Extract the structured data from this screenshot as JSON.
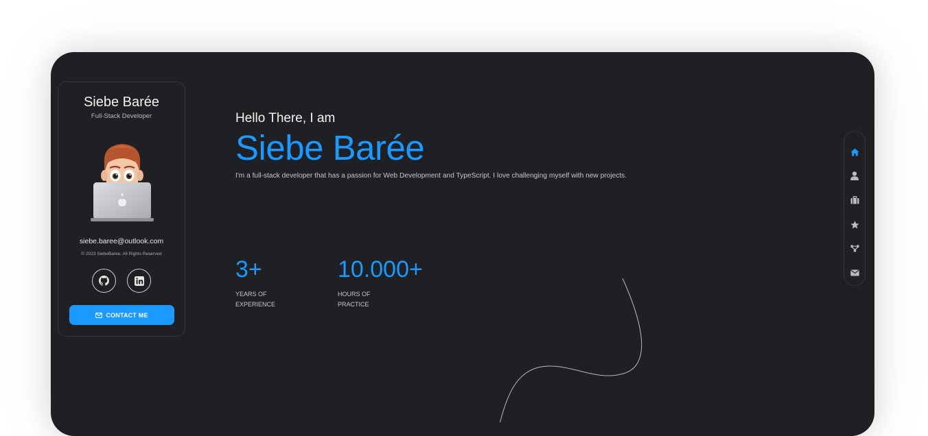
{
  "profile": {
    "name": "Siebe Barée",
    "role": "Full-Stack Developer",
    "email": "siebe.baree@outlook.com",
    "copyright": "© 2023 SiebeBaree. All Rights Reserved",
    "socials": [
      {
        "icon": "github-icon"
      },
      {
        "icon": "linkedin-icon"
      }
    ],
    "contact_label": "CONTACT ME"
  },
  "hero": {
    "greeting": "Hello There, I am",
    "name": "Siebe Barée",
    "bio": "I'm a full-stack developer that has a passion for Web Development and TypeScript. I love challenging myself with new projects."
  },
  "stats": [
    {
      "value": "3+",
      "label": "YEARS OF EXPERIENCE"
    },
    {
      "value": "10.000+",
      "label": "HOURS OF PRACTICE"
    }
  ],
  "nav": [
    {
      "icon": "home-icon",
      "active": true
    },
    {
      "icon": "user-icon",
      "active": false
    },
    {
      "icon": "briefcase-icon",
      "active": false
    },
    {
      "icon": "star-icon",
      "active": false
    },
    {
      "icon": "network-icon",
      "active": false
    },
    {
      "icon": "mail-icon",
      "active": false
    }
  ],
  "colors": {
    "accent": "#1a99ff",
    "background": "#1f2023",
    "page": "#ffffff"
  }
}
